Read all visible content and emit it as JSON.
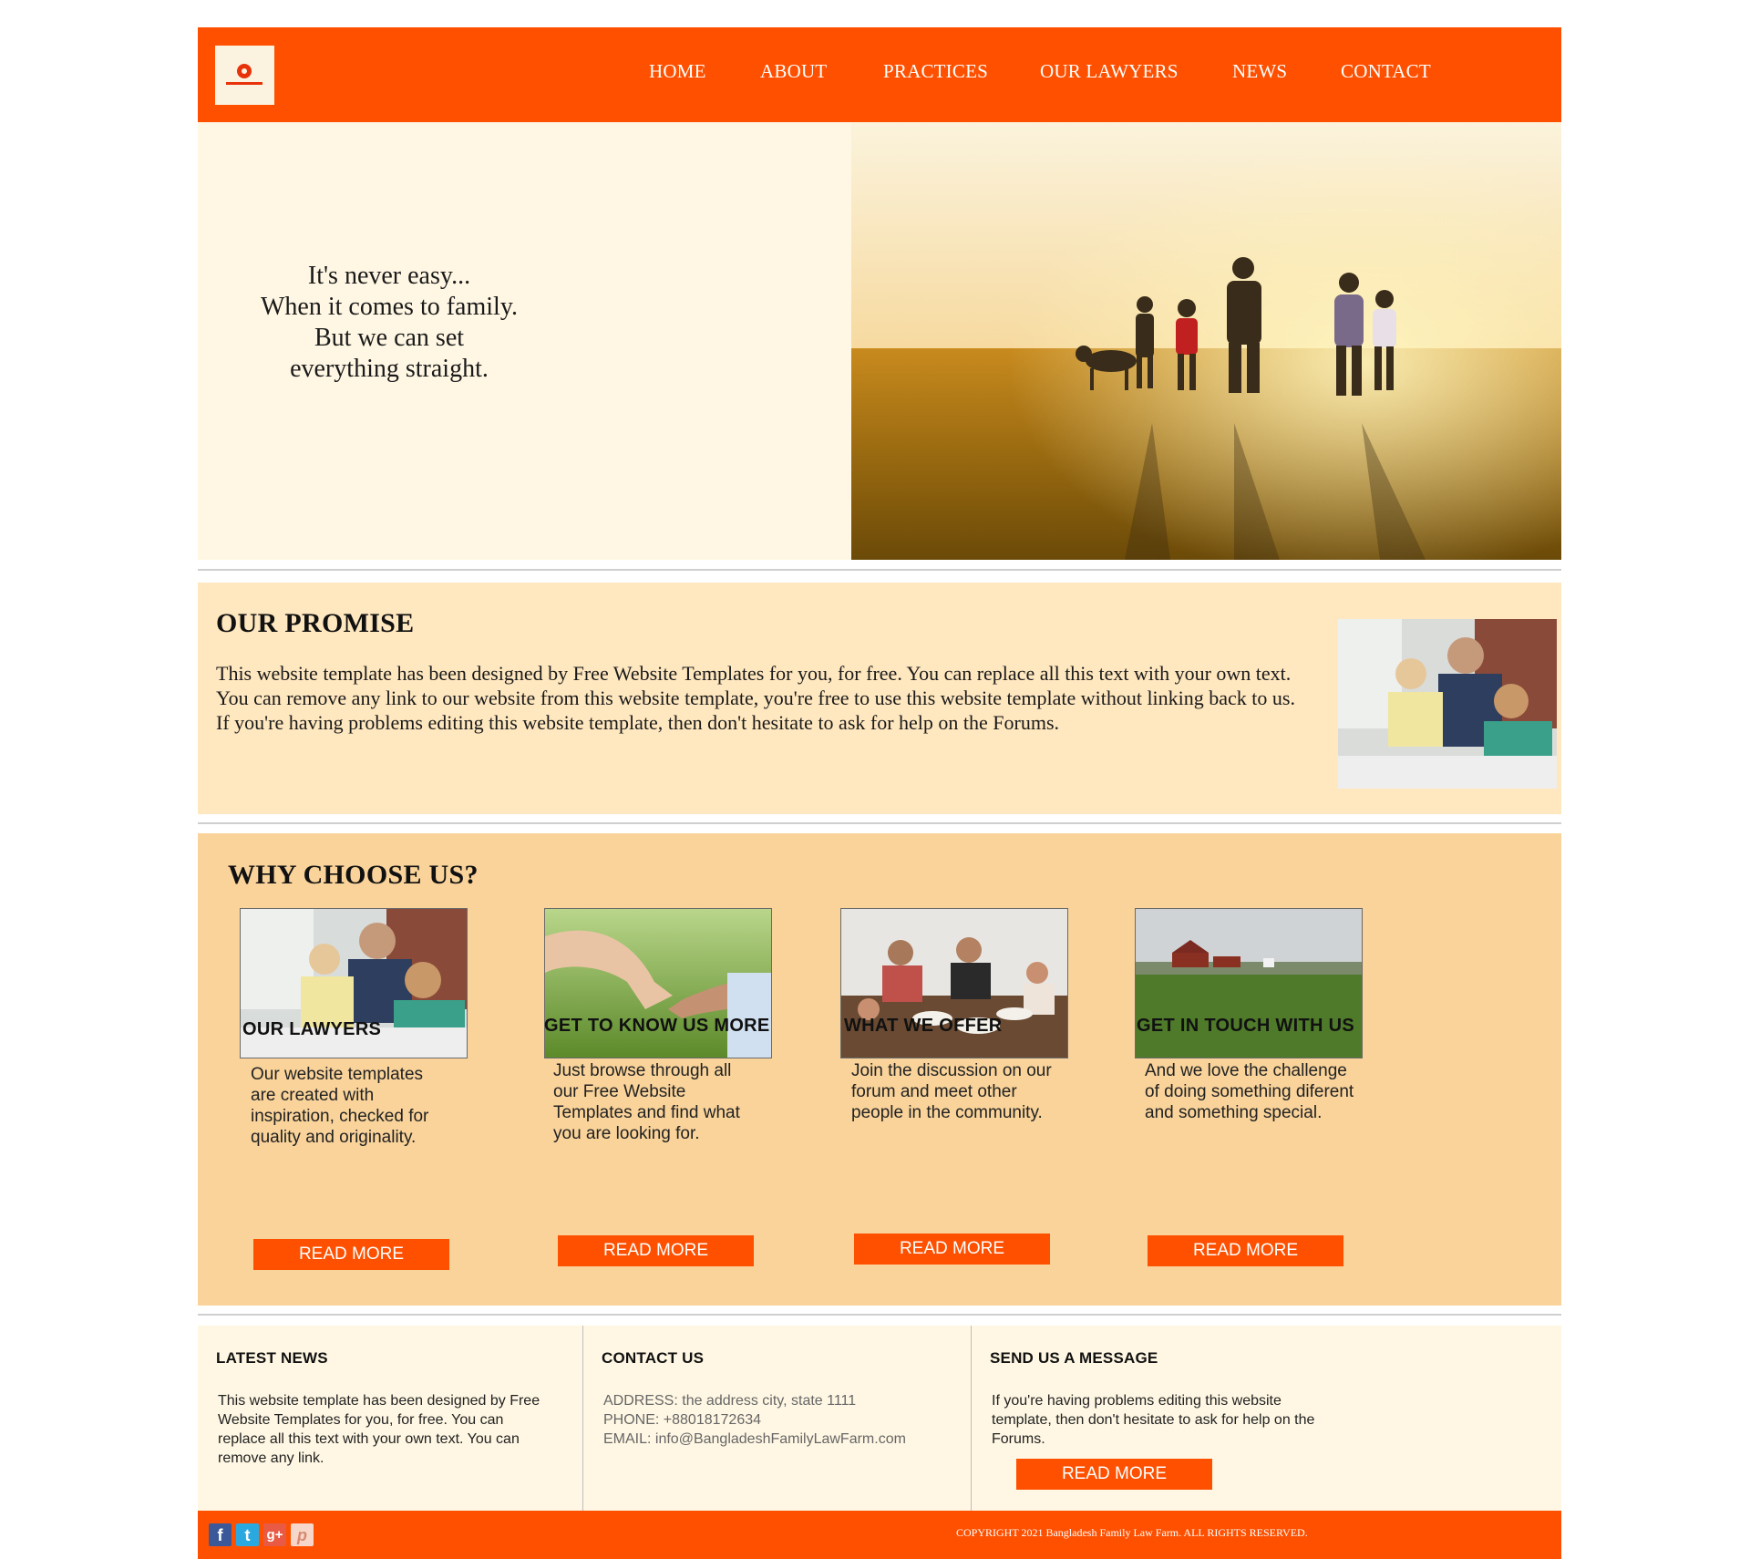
{
  "header": {
    "logo_icon": "company-logo-icon",
    "nav": [
      {
        "label": "HOME"
      },
      {
        "label": "ABOUT"
      },
      {
        "label": "PRACTICES"
      },
      {
        "label": "OUR LAWYERS"
      },
      {
        "label": "NEWS"
      },
      {
        "label": "CONTACT"
      }
    ]
  },
  "hero": {
    "line1": "It's never easy...",
    "line2": "When it comes to family.",
    "line3": "But we can set",
    "line4": "everything straight."
  },
  "promise": {
    "title": "OUR PROMISE",
    "text": "This website template has been designed by Free Website Templates for you, for free. You can replace all this text with your own text. You can remove any link to our website from this website template, you're free to use this website template without linking back to us. If you're having problems editing this website template, then don't hesitate to ask for help on the Forums."
  },
  "why": {
    "title": "WHY CHOOSE US?",
    "cards": [
      {
        "title": "OUR LAWYERS",
        "text": "Our website templates are created with inspiration, checked for quality and originality.",
        "button": "READ MORE"
      },
      {
        "title": "GET TO KNOW US MORE",
        "text": "Just browse through all our Free Website Templates and find what you are looking for.",
        "button": "READ MORE"
      },
      {
        "title": "WHAT WE OFFER",
        "text": "Join the discussion on our forum and meet other people in the community.",
        "button": "READ MORE"
      },
      {
        "title": "GET IN TOUCH WITH US",
        "text": "And we love the challenge of doing something diferent and something special.",
        "button": "READ MORE"
      }
    ]
  },
  "footer": {
    "news": {
      "title": "LATEST NEWS",
      "text": "This website template has been designed by Free Website Templates for you, for free. You can replace all this text with your own text. You can remove any link."
    },
    "contact": {
      "title": "CONTACT US",
      "address": "ADDRESS: the address city, state 1111",
      "phone": "PHONE: +88018172634",
      "email": "EMAIL: info@BangladeshFamilyLawFarm.com"
    },
    "message": {
      "title": "SEND US A MESSAGE",
      "text": "If you're having problems editing this website template, then don't hesitate to ask for help on the Forums.",
      "button": "READ MORE"
    }
  },
  "bottom": {
    "social": [
      {
        "icon": "facebook-icon",
        "glyph": "f",
        "color": "#3b5998"
      },
      {
        "icon": "twitter-icon",
        "glyph": "t",
        "color": "#2aa9e0"
      },
      {
        "icon": "google-plus-icon",
        "glyph": "g+",
        "color": "#e85a44"
      },
      {
        "icon": "pinterest-icon",
        "glyph": "p",
        "color": "#f6d7c9"
      }
    ],
    "copyright": "COPYRIGHT 2021 Bangladesh Family Law Farm. ALL RIGHTS RESERVED."
  },
  "colors": {
    "brand": "#ff5000",
    "hero_bg": "#fff7e3",
    "promise_bg": "#ffe7bf",
    "why_bg": "#f9d39a"
  }
}
